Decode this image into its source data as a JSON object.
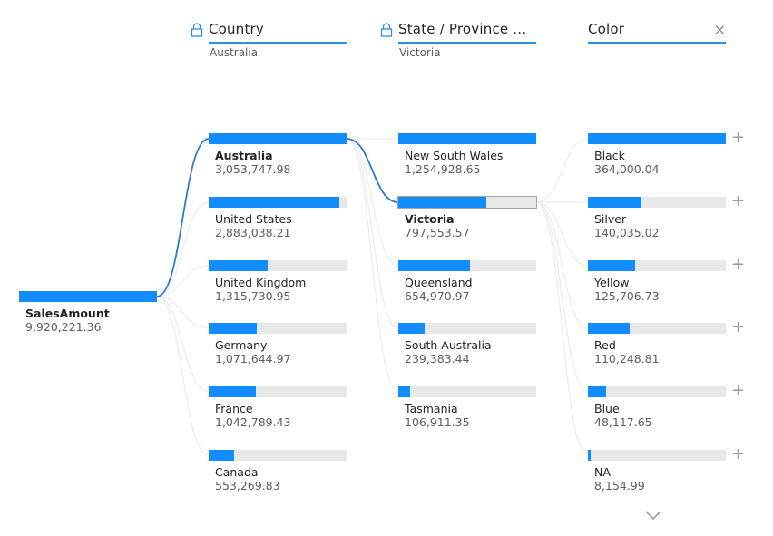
{
  "visual": {
    "type": "decomposition-tree",
    "accent_color": "#118dff",
    "track_color": "#e8e8e8",
    "highlight_path_color": "#2b7bd4",
    "root": {
      "label": "SalesAmount",
      "value": "9,920,221.36",
      "raw": 9920221.36
    },
    "levels": [
      {
        "header": "Country",
        "locked": true,
        "selected_value": "Australia",
        "max": 3053747.98,
        "items": [
          {
            "label": "Australia",
            "value": "3,053,747.98",
            "raw": 3053747.98,
            "selected": true
          },
          {
            "label": "United States",
            "value": "2,883,038.21",
            "raw": 2883038.21
          },
          {
            "label": "United Kingdom",
            "value": "1,315,730.95",
            "raw": 1315730.95
          },
          {
            "label": "Germany",
            "value": "1,071,644.97",
            "raw": 1071644.97
          },
          {
            "label": "France",
            "value": "1,042,789.43",
            "raw": 1042789.43
          },
          {
            "label": "Canada",
            "value": "553,269.83",
            "raw": 553269.83
          }
        ]
      },
      {
        "header": "State / Province ...",
        "locked": true,
        "selected_value": "Victoria",
        "max": 1254928.65,
        "items": [
          {
            "label": "New South Wales",
            "value": "1,254,928.65",
            "raw": 1254928.65
          },
          {
            "label": "Victoria",
            "value": "797,553.57",
            "raw": 797553.57,
            "selected": true
          },
          {
            "label": "Queensland",
            "value": "654,970.97",
            "raw": 654970.97
          },
          {
            "label": "South Australia",
            "value": "239,383.44",
            "raw": 239383.44
          },
          {
            "label": "Tasmania",
            "value": "106,911.35",
            "raw": 106911.35
          }
        ]
      },
      {
        "header": "Color",
        "locked": false,
        "closable": true,
        "close_icon": "×",
        "max": 364000.04,
        "expand_icon": "+",
        "items": [
          {
            "label": "Black",
            "value": "364,000.04",
            "raw": 364000.04
          },
          {
            "label": "Silver",
            "value": "140,035.02",
            "raw": 140035.02
          },
          {
            "label": "Yellow",
            "value": "125,706.73",
            "raw": 125706.73
          },
          {
            "label": "Red",
            "value": "110,248.81",
            "raw": 110248.81
          },
          {
            "label": "Blue",
            "value": "48,117.65",
            "raw": 48117.65
          },
          {
            "label": "NA",
            "value": "8,154.99",
            "raw": 8154.99
          }
        ]
      }
    ],
    "more_icon": "chevron-down"
  }
}
